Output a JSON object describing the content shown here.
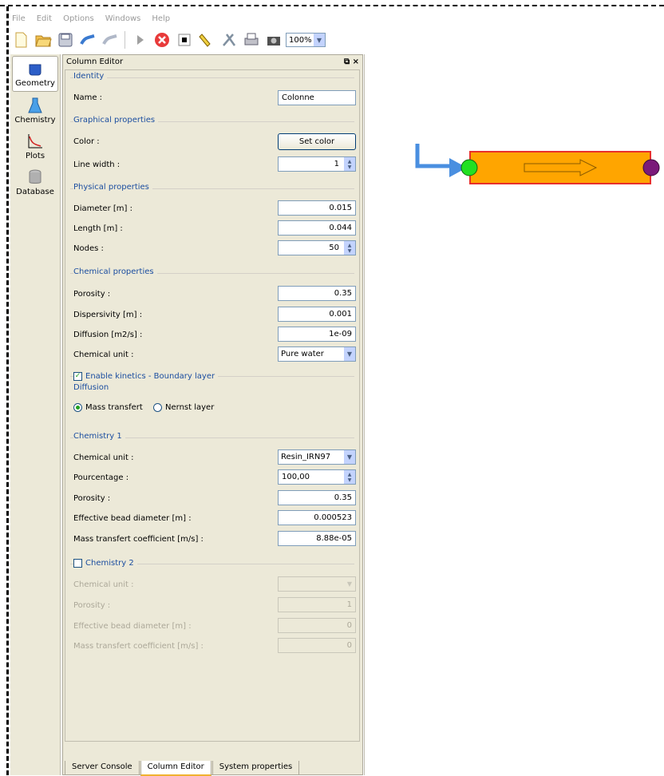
{
  "menu": [
    "File",
    "Edit",
    "Options",
    "Windows",
    "Help"
  ],
  "toolbar": {
    "icons": [
      "new-file-icon",
      "open-folder-icon",
      "save-icon",
      "edit-icon",
      "erase-icon",
      "play-icon",
      "stop-icon",
      "square-icon",
      "pencil-icon",
      "tools-icon",
      "print-icon",
      "camera-icon"
    ],
    "zoom": "100%"
  },
  "sidebar": {
    "items": [
      {
        "label": "Geometry",
        "icon": "beaker-icon"
      },
      {
        "label": "Chemistry",
        "icon": "flask-icon"
      },
      {
        "label": "Plots",
        "icon": "plot-icon"
      },
      {
        "label": "Database",
        "icon": "database-icon"
      }
    ]
  },
  "editor": {
    "title": "Column Editor",
    "controls": "% ×",
    "identity": {
      "header": "Identity",
      "name_label": "Name :",
      "name_value": "Colonne"
    },
    "graphical": {
      "header": "Graphical properties",
      "color_label": "Color :",
      "color_button": "Set color",
      "line_width_label": "Line width :",
      "line_width_value": "1"
    },
    "physical": {
      "header": "Physical properties",
      "diameter_label": "Diameter [m] :",
      "diameter_value": "0.015",
      "length_label": "Length [m] :",
      "length_value": "0.044",
      "nodes_label": "Nodes :",
      "nodes_value": "50"
    },
    "chemical": {
      "header": "Chemical properties",
      "porosity_label": "Porosity :",
      "porosity_value": "0.35",
      "dispersivity_label": "Dispersivity [m] :",
      "dispersivity_value": "0.001",
      "diffusion_label": "Diffusion [m2/s] :",
      "diffusion_value": "1e-09",
      "unit_label": "Chemical unit :",
      "unit_value": "Pure water"
    },
    "kinetics": {
      "label": "Enable kinetics - Boundary layer",
      "diffusion_header": "Diffusion",
      "mass_transfert": "Mass transfert",
      "nernst": "Nernst layer"
    },
    "chem1": {
      "header": "Chemistry 1",
      "unit_label": "Chemical unit :",
      "unit_value": "Resin_IRN97",
      "pourcentage_label": "Pourcentage :",
      "pourcentage_value": "100,00",
      "porosity_label": "Porosity :",
      "porosity_value": "0.35",
      "bead_label": "Effective bead diameter [m] :",
      "bead_value": "0.000523",
      "mass_label": "Mass transfert coefficient [m/s] :",
      "mass_value": "8.88e-05"
    },
    "chem2": {
      "header": "Chemistry 2",
      "unit_label": "Chemical unit :",
      "unit_value": "",
      "porosity_label": "Porosity :",
      "porosity_value": "1",
      "bead_label": "Effective bead diameter [m] :",
      "bead_value": "0",
      "mass_label": "Mass transfert coefficient [m/s] :",
      "mass_value": "0"
    }
  },
  "bottom_tabs": [
    "Server Console",
    "Column Editor",
    "System properties"
  ],
  "canvas": {
    "column_fill": "#ffa500",
    "column_border": "#e8302a",
    "inlet_color": "#22e022",
    "outlet_color": "#7a1a7a",
    "arrow_color": "#4a8fe0"
  }
}
